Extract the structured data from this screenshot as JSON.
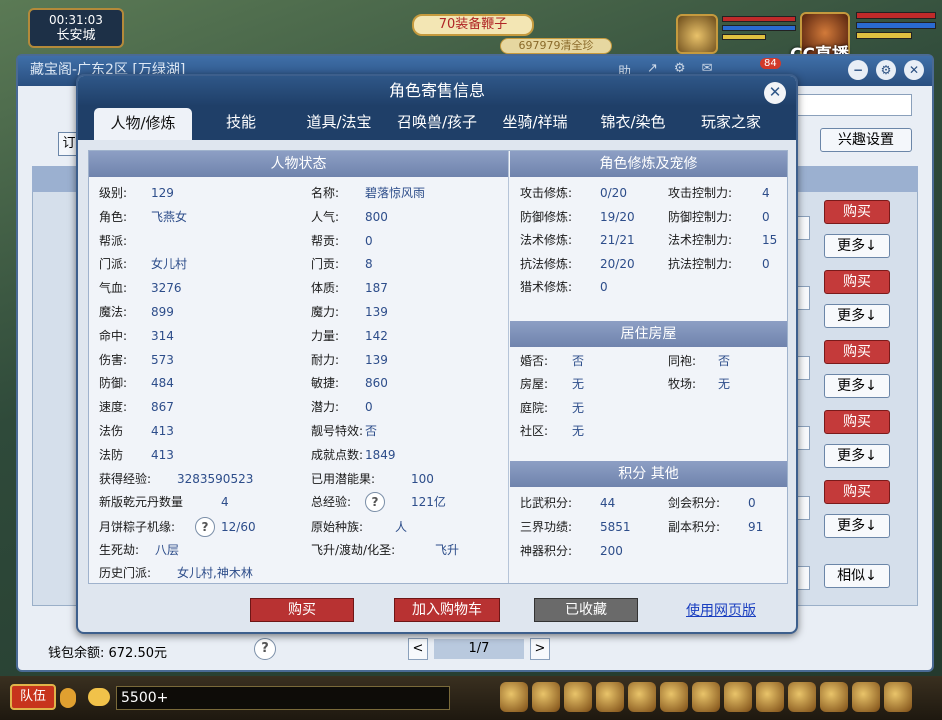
{
  "hud": {
    "time": "00:31:03",
    "city": "长安城",
    "banner": "70装备鞭子",
    "banner2": "697979清全珍",
    "cc_logo": "CC直播"
  },
  "outer": {
    "title": "藏宝阁-广东2区 [万绿湖]",
    "tool_label": "助",
    "badge": "84",
    "interest_button": "兴趣设置",
    "left_btn": "订",
    "buy_label": "购买",
    "more_label": "更多↓",
    "similar_label": "相似↓",
    "wallet": "钱包余额: 672.50元",
    "help": "?",
    "page": "1/7",
    "prev": "<",
    "next": ">"
  },
  "dialog": {
    "title": "角色寄售信息",
    "close": "✕",
    "tabs": [
      "人物/修炼",
      "技能",
      "道具/法宝",
      "召唤兽/孩子",
      "坐骑/祥瑞",
      "锦衣/染色",
      "玩家之家"
    ],
    "status_title": "人物状态",
    "left_col": [
      {
        "k": "级别:",
        "v": "129"
      },
      {
        "k": "角色:",
        "v": "飞燕女"
      },
      {
        "k": "帮派:",
        "v": ""
      },
      {
        "k": "门派:",
        "v": "女儿村"
      },
      {
        "k": "气血:",
        "v": "3276"
      },
      {
        "k": "魔法:",
        "v": "899"
      },
      {
        "k": "命中:",
        "v": "314"
      },
      {
        "k": "伤害:",
        "v": "573"
      },
      {
        "k": "防御:",
        "v": "484"
      },
      {
        "k": "速度:",
        "v": "867"
      },
      {
        "k": "法伤",
        "v": "413"
      },
      {
        "k": "法防",
        "v": "413"
      }
    ],
    "mid_col": [
      {
        "k": "名称:",
        "v": "碧落惊风雨"
      },
      {
        "k": "人气:",
        "v": "800"
      },
      {
        "k": "帮贡:",
        "v": "0"
      },
      {
        "k": "门贡:",
        "v": "8"
      },
      {
        "k": "体质:",
        "v": "187"
      },
      {
        "k": "魔力:",
        "v": "139"
      },
      {
        "k": "力量:",
        "v": "142"
      },
      {
        "k": "耐力:",
        "v": "139"
      },
      {
        "k": "敏捷:",
        "v": "860"
      },
      {
        "k": "潜力:",
        "v": "0"
      },
      {
        "k": "靓号特效:",
        "v": "否"
      },
      {
        "k": "成就点数:",
        "v": "1849"
      }
    ],
    "extra": {
      "exp_k": "获得经验:",
      "exp_v": "3283590523",
      "qianyuan_k": "新版乾元丹数量",
      "qianyuan_v": "4",
      "yuebing_k": "月饼粽子机缘:",
      "yuebing_v": "12/60",
      "shengsi_k": "生死劫:",
      "shengsi_v": "八层",
      "history_k": "历史门派:",
      "history_v": "女儿村,神木林",
      "used_pot_k": "已用潜能果:",
      "used_pot_v": "100",
      "total_exp_k": "总经验:",
      "total_exp_v": "121亿",
      "race_k": "原始种族:",
      "race_v": "人",
      "fly_k": "飞升/渡劫/化圣:",
      "fly_v": "飞升"
    },
    "cultivation_title": "角色修炼及宠修",
    "cultivation": [
      {
        "k": "攻击修炼:",
        "v": "0/20"
      },
      {
        "k": "防御修炼:",
        "v": "19/20"
      },
      {
        "k": "法术修炼:",
        "v": "21/21"
      },
      {
        "k": "抗法修炼:",
        "v": "20/20"
      },
      {
        "k": "猎术修炼:",
        "v": "0"
      }
    ],
    "control": [
      {
        "k": "攻击控制力:",
        "v": "4"
      },
      {
        "k": "防御控制力:",
        "v": "0"
      },
      {
        "k": "法术控制力:",
        "v": "15"
      },
      {
        "k": "抗法控制力:",
        "v": "0"
      }
    ],
    "housing_title": "居住房屋",
    "housing": [
      {
        "k": "婚否:",
        "v": "否"
      },
      {
        "k": "房屋:",
        "v": "无"
      },
      {
        "k": "庭院:",
        "v": "无"
      },
      {
        "k": "社区:",
        "v": "无"
      }
    ],
    "housing2": [
      {
        "k": "同袍:",
        "v": "否"
      },
      {
        "k": "牧场:",
        "v": "无"
      }
    ],
    "points_title": "积分 其他",
    "points": [
      {
        "k": "比武积分:",
        "v": "44"
      },
      {
        "k": "三界功绩:",
        "v": "5851"
      },
      {
        "k": "神器积分:",
        "v": "200"
      }
    ],
    "points2": [
      {
        "k": "剑会积分:",
        "v": "0"
      },
      {
        "k": "副本积分:",
        "v": "91"
      }
    ],
    "actions": {
      "buy": "购买",
      "cart": "加入购物车",
      "fav": "已收藏",
      "web": "使用网页版"
    }
  },
  "bottom": {
    "team": "队伍",
    "chat_value": "5500+"
  }
}
